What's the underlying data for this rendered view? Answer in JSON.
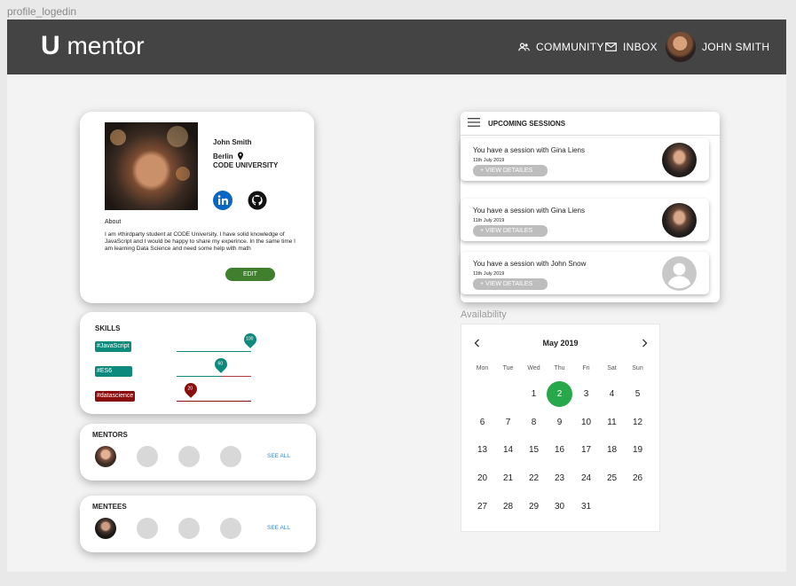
{
  "frame_label": "profile_logedin",
  "header": {
    "logo_u": "U",
    "logo_text": "mentor",
    "community": "COMMUNITY",
    "inbox": "INBOX",
    "user": "JOHN SMITH"
  },
  "profile": {
    "name": "John Smith",
    "city": "Berlin",
    "university": "CODE UNIVERSITY",
    "about_title": "About",
    "about_text": "I am #thirdparty student at CODE University. I have solid knowledge of JavaScript and I would be happy to share my experince. In the same time I am learning Data Science and need some help with math",
    "edit_label": "EDIT"
  },
  "skills": {
    "title": "SKILLS",
    "items": [
      {
        "tag": "#JavaScript",
        "level": "100",
        "color": "#0e8a7d"
      },
      {
        "tag": "#ES6",
        "level": "60",
        "color": "#0e8a7d"
      },
      {
        "tag": "#datascience",
        "level": "20",
        "color": "#8b0e0e"
      }
    ]
  },
  "mentors": {
    "title": "MENTORS",
    "see_all": "SEE ALL"
  },
  "mentees": {
    "title": "MENTEES",
    "see_all": "SEE ALL"
  },
  "sessions": {
    "title": "UPCOMING SESSIONS",
    "items": [
      {
        "text": "You have a session with Gina Liens",
        "date": "11th July 2019",
        "button": "+ VIEW DETAILES"
      },
      {
        "text": "You have a session with Gina Liens",
        "date": "11th July 2019",
        "button": "+ VIEW DETAILES"
      },
      {
        "text": "You have a session with  John Snow",
        "date": "11th July 2019",
        "button": "+ VIEW DETAILES"
      }
    ]
  },
  "availability": {
    "label": "Availability",
    "month": "May 2019",
    "weekdays": [
      "Mon",
      "Tue",
      "Wed",
      "Thu",
      "Fri",
      "Sat",
      "Sun"
    ],
    "days": [
      "1",
      "2",
      "3",
      "4",
      "5",
      "6",
      "7",
      "8",
      "9",
      "10",
      "11",
      "12",
      "13",
      "14",
      "15",
      "16",
      "17",
      "18",
      "19",
      "20",
      "21",
      "22",
      "23",
      "24",
      "25",
      "26",
      "27",
      "28",
      "29",
      "30",
      "31"
    ],
    "selected_day": "2",
    "accent": "#27a84a"
  }
}
